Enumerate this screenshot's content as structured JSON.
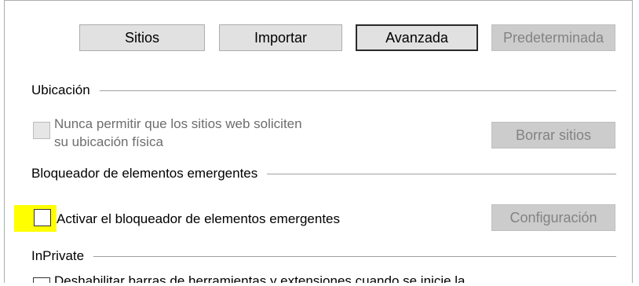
{
  "toolbar": {
    "sites": "Sitios",
    "import": "Importar",
    "advanced": "Avanzada",
    "default": "Predeterminada"
  },
  "location": {
    "heading": "Ubicación",
    "never_allow_line1": "Nunca permitir que los sitios web soliciten",
    "never_allow_line2": "su ubicación física",
    "never_allow_checked": false,
    "clear_sites": "Borrar sitios"
  },
  "popup_blocker": {
    "heading": "Bloqueador de elementos emergentes",
    "enable_label": "Activar el bloqueador de elementos emergentes",
    "enable_checked": false,
    "settings": "Configuración"
  },
  "inprivate": {
    "heading": "InPrivate",
    "disable_toolbars_label": "Deshabilitar barras de herramientas y extensiones cuando se inicie la"
  },
  "colors": {
    "highlight": "#ffff00",
    "button_bg": "#e1e1e1",
    "button_disabled_bg": "#cccccc"
  }
}
